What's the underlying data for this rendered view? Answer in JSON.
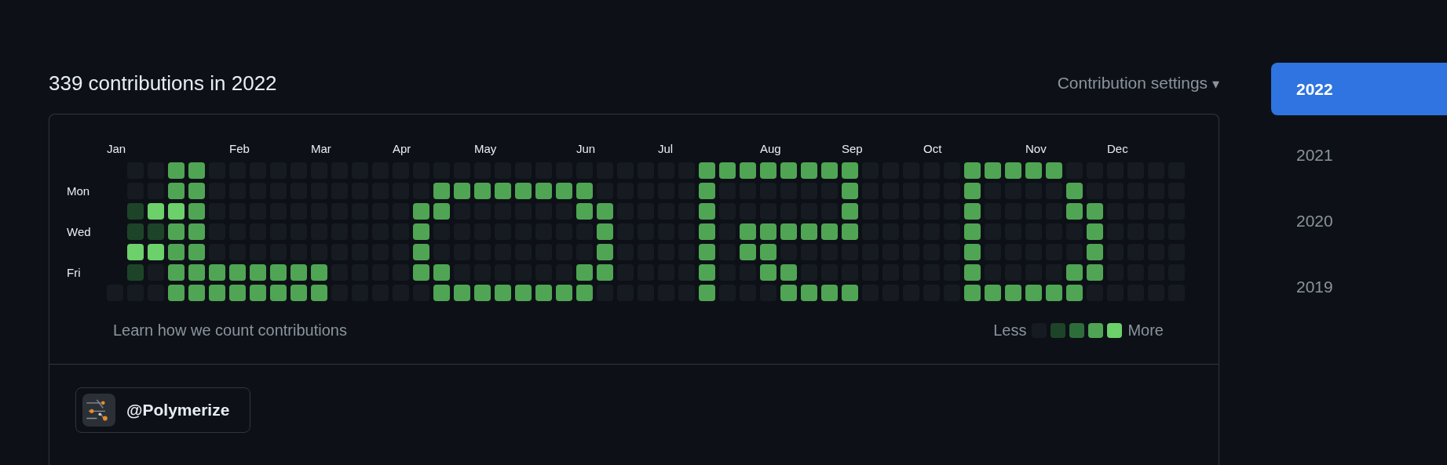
{
  "heading": "339 contributions in 2022",
  "settings_menu": {
    "label": "Contribution settings",
    "caret": "▾"
  },
  "years": [
    {
      "label": "2022",
      "selected": true
    },
    {
      "label": "2021",
      "selected": false
    },
    {
      "label": "2020",
      "selected": false
    },
    {
      "label": "2019",
      "selected": false
    }
  ],
  "day_labels": [
    "Mon",
    "Wed",
    "Fri"
  ],
  "weeks": [
    {
      "month": "Jan",
      "days": [
        {
          "color": "#161b22"
        }
      ]
    },
    {
      "days": [
        {
          "color": "#161b22"
        },
        {
          "color": "#161b22"
        },
        {
          "color": "#1d4428"
        },
        {
          "color": "#1d4428"
        },
        {
          "color": "#6cd06b"
        },
        {
          "color": "#1d4428"
        },
        {
          "color": "#161b22"
        }
      ]
    },
    {
      "days": [
        {
          "color": "#161b22"
        },
        {
          "color": "#161b22"
        },
        {
          "color": "#6cd06b"
        },
        {
          "color": "#1d4428"
        },
        {
          "color": "#6cd06b"
        },
        {
          "color": "#161b22"
        },
        {
          "color": "#161b22"
        }
      ]
    },
    {
      "days": [
        {
          "color": "#4fa553"
        },
        {
          "color": "#4fa553"
        },
        {
          "color": "#6cd06b"
        },
        {
          "color": "#4fa553"
        },
        {
          "color": "#4fa553"
        },
        {
          "color": "#4fa553"
        },
        {
          "color": "#4fa553"
        }
      ]
    },
    {
      "days": [
        {
          "color": "#4fa553"
        },
        {
          "color": "#4fa553"
        },
        {
          "color": "#4fa553"
        },
        {
          "color": "#4fa553"
        },
        {
          "color": "#4fa553"
        },
        {
          "color": "#4fa553"
        },
        {
          "color": "#4fa553"
        }
      ]
    },
    {
      "days": [
        {
          "color": "#161b22"
        },
        {
          "color": "#161b22"
        },
        {
          "color": "#161b22"
        },
        {
          "color": "#161b22"
        },
        {
          "color": "#161b22"
        },
        {
          "color": "#4fa553"
        },
        {
          "color": "#4fa553"
        }
      ]
    },
    {
      "month": "Feb",
      "days": [
        {
          "color": "#161b22"
        },
        {
          "color": "#161b22"
        },
        {
          "color": "#161b22"
        },
        {
          "color": "#161b22"
        },
        {
          "color": "#161b22"
        },
        {
          "color": "#4fa553"
        },
        {
          "color": "#4fa553"
        }
      ]
    },
    {
      "days": [
        {
          "color": "#161b22"
        },
        {
          "color": "#161b22"
        },
        {
          "color": "#161b22"
        },
        {
          "color": "#161b22"
        },
        {
          "color": "#161b22"
        },
        {
          "color": "#4fa553"
        },
        {
          "color": "#4fa553"
        }
      ]
    },
    {
      "days": [
        {
          "color": "#161b22"
        },
        {
          "color": "#161b22"
        },
        {
          "color": "#161b22"
        },
        {
          "color": "#161b22"
        },
        {
          "color": "#161b22"
        },
        {
          "color": "#4fa553"
        },
        {
          "color": "#4fa553"
        }
      ]
    },
    {
      "days": [
        {
          "color": "#161b22"
        },
        {
          "color": "#161b22"
        },
        {
          "color": "#161b22"
        },
        {
          "color": "#161b22"
        },
        {
          "color": "#161b22"
        },
        {
          "color": "#4fa553"
        },
        {
          "color": "#4fa553"
        }
      ]
    },
    {
      "month": "Mar",
      "days": [
        {
          "color": "#161b22"
        },
        {
          "color": "#161b22"
        },
        {
          "color": "#161b22"
        },
        {
          "color": "#161b22"
        },
        {
          "color": "#161b22"
        },
        {
          "color": "#4fa553"
        },
        {
          "color": "#4fa553"
        }
      ]
    },
    {
      "days": [
        {
          "color": "#161b22"
        },
        {
          "color": "#161b22"
        },
        {
          "color": "#161b22"
        },
        {
          "color": "#161b22"
        },
        {
          "color": "#161b22"
        },
        {
          "color": "#161b22"
        },
        {
          "color": "#161b22"
        }
      ]
    },
    {
      "days": [
        {
          "color": "#161b22"
        },
        {
          "color": "#161b22"
        },
        {
          "color": "#161b22"
        },
        {
          "color": "#161b22"
        },
        {
          "color": "#161b22"
        },
        {
          "color": "#161b22"
        },
        {
          "color": "#161b22"
        }
      ]
    },
    {
      "days": [
        {
          "color": "#161b22"
        },
        {
          "color": "#161b22"
        },
        {
          "color": "#161b22"
        },
        {
          "color": "#161b22"
        },
        {
          "color": "#161b22"
        },
        {
          "color": "#161b22"
        },
        {
          "color": "#161b22"
        }
      ]
    },
    {
      "month": "Apr",
      "days": [
        {
          "color": "#161b22"
        },
        {
          "color": "#161b22"
        },
        {
          "color": "#161b22"
        },
        {
          "color": "#161b22"
        },
        {
          "color": "#161b22"
        },
        {
          "color": "#161b22"
        },
        {
          "color": "#161b22"
        }
      ]
    },
    {
      "days": [
        {
          "color": "#161b22"
        },
        {
          "color": "#161b22"
        },
        {
          "color": "#4fa553"
        },
        {
          "color": "#4fa553"
        },
        {
          "color": "#4fa553"
        },
        {
          "color": "#4fa553"
        },
        {
          "color": "#161b22"
        }
      ]
    },
    {
      "days": [
        {
          "color": "#161b22"
        },
        {
          "color": "#4fa553"
        },
        {
          "color": "#4fa553"
        },
        {
          "color": "#161b22"
        },
        {
          "color": "#161b22"
        },
        {
          "color": "#4fa553"
        },
        {
          "color": "#4fa553"
        }
      ]
    },
    {
      "days": [
        {
          "color": "#161b22"
        },
        {
          "color": "#4fa553"
        },
        {
          "color": "#161b22"
        },
        {
          "color": "#161b22"
        },
        {
          "color": "#161b22"
        },
        {
          "color": "#161b22"
        },
        {
          "color": "#4fa553"
        }
      ]
    },
    {
      "month": "May",
      "days": [
        {
          "color": "#161b22"
        },
        {
          "color": "#4fa553"
        },
        {
          "color": "#161b22"
        },
        {
          "color": "#161b22"
        },
        {
          "color": "#161b22"
        },
        {
          "color": "#161b22"
        },
        {
          "color": "#4fa553"
        }
      ]
    },
    {
      "days": [
        {
          "color": "#161b22"
        },
        {
          "color": "#4fa553"
        },
        {
          "color": "#161b22"
        },
        {
          "color": "#161b22"
        },
        {
          "color": "#161b22"
        },
        {
          "color": "#161b22"
        },
        {
          "color": "#4fa553"
        }
      ]
    },
    {
      "days": [
        {
          "color": "#161b22"
        },
        {
          "color": "#4fa553"
        },
        {
          "color": "#161b22"
        },
        {
          "color": "#161b22"
        },
        {
          "color": "#161b22"
        },
        {
          "color": "#161b22"
        },
        {
          "color": "#4fa553"
        }
      ]
    },
    {
      "days": [
        {
          "color": "#161b22"
        },
        {
          "color": "#4fa553"
        },
        {
          "color": "#161b22"
        },
        {
          "color": "#161b22"
        },
        {
          "color": "#161b22"
        },
        {
          "color": "#161b22"
        },
        {
          "color": "#4fa553"
        }
      ]
    },
    {
      "days": [
        {
          "color": "#161b22"
        },
        {
          "color": "#4fa553"
        },
        {
          "color": "#161b22"
        },
        {
          "color": "#161b22"
        },
        {
          "color": "#161b22"
        },
        {
          "color": "#161b22"
        },
        {
          "color": "#4fa553"
        }
      ]
    },
    {
      "month": "Jun",
      "days": [
        {
          "color": "#161b22"
        },
        {
          "color": "#4fa553"
        },
        {
          "color": "#4fa553"
        },
        {
          "color": "#161b22"
        },
        {
          "color": "#161b22"
        },
        {
          "color": "#4fa553"
        },
        {
          "color": "#4fa553"
        }
      ]
    },
    {
      "days": [
        {
          "color": "#161b22"
        },
        {
          "color": "#161b22"
        },
        {
          "color": "#4fa553"
        },
        {
          "color": "#4fa553"
        },
        {
          "color": "#4fa553"
        },
        {
          "color": "#4fa553"
        },
        {
          "color": "#161b22"
        }
      ]
    },
    {
      "days": [
        {
          "color": "#161b22"
        },
        {
          "color": "#161b22"
        },
        {
          "color": "#161b22"
        },
        {
          "color": "#161b22"
        },
        {
          "color": "#161b22"
        },
        {
          "color": "#161b22"
        },
        {
          "color": "#161b22"
        }
      ]
    },
    {
      "days": [
        {
          "color": "#161b22"
        },
        {
          "color": "#161b22"
        },
        {
          "color": "#161b22"
        },
        {
          "color": "#161b22"
        },
        {
          "color": "#161b22"
        },
        {
          "color": "#161b22"
        },
        {
          "color": "#161b22"
        }
      ]
    },
    {
      "month": "Jul",
      "days": [
        {
          "color": "#161b22"
        },
        {
          "color": "#161b22"
        },
        {
          "color": "#161b22"
        },
        {
          "color": "#161b22"
        },
        {
          "color": "#161b22"
        },
        {
          "color": "#161b22"
        },
        {
          "color": "#161b22"
        }
      ]
    },
    {
      "days": [
        {
          "color": "#161b22"
        },
        {
          "color": "#161b22"
        },
        {
          "color": "#161b22"
        },
        {
          "color": "#161b22"
        },
        {
          "color": "#161b22"
        },
        {
          "color": "#161b22"
        },
        {
          "color": "#161b22"
        }
      ]
    },
    {
      "days": [
        {
          "color": "#4fa553"
        },
        {
          "color": "#4fa553"
        },
        {
          "color": "#4fa553"
        },
        {
          "color": "#4fa553"
        },
        {
          "color": "#4fa553"
        },
        {
          "color": "#4fa553"
        },
        {
          "color": "#4fa553"
        }
      ]
    },
    {
      "days": [
        {
          "color": "#4fa553"
        },
        {
          "color": "#161b22"
        },
        {
          "color": "#161b22"
        },
        {
          "color": "#161b22"
        },
        {
          "color": "#161b22"
        },
        {
          "color": "#161b22"
        },
        {
          "color": "#161b22"
        }
      ]
    },
    {
      "days": [
        {
          "color": "#4fa553"
        },
        {
          "color": "#161b22"
        },
        {
          "color": "#161b22"
        },
        {
          "color": "#4fa553"
        },
        {
          "color": "#4fa553"
        },
        {
          "color": "#161b22"
        },
        {
          "color": "#161b22"
        }
      ]
    },
    {
      "month": "Aug",
      "days": [
        {
          "color": "#4fa553"
        },
        {
          "color": "#161b22"
        },
        {
          "color": "#161b22"
        },
        {
          "color": "#4fa553"
        },
        {
          "color": "#4fa553"
        },
        {
          "color": "#4fa553"
        },
        {
          "color": "#161b22"
        }
      ]
    },
    {
      "days": [
        {
          "color": "#4fa553"
        },
        {
          "color": "#161b22"
        },
        {
          "color": "#161b22"
        },
        {
          "color": "#4fa553"
        },
        {
          "color": "#161b22"
        },
        {
          "color": "#4fa553"
        },
        {
          "color": "#4fa553"
        }
      ]
    },
    {
      "days": [
        {
          "color": "#4fa553"
        },
        {
          "color": "#161b22"
        },
        {
          "color": "#161b22"
        },
        {
          "color": "#4fa553"
        },
        {
          "color": "#161b22"
        },
        {
          "color": "#161b22"
        },
        {
          "color": "#4fa553"
        }
      ]
    },
    {
      "days": [
        {
          "color": "#4fa553"
        },
        {
          "color": "#161b22"
        },
        {
          "color": "#161b22"
        },
        {
          "color": "#4fa553"
        },
        {
          "color": "#161b22"
        },
        {
          "color": "#161b22"
        },
        {
          "color": "#4fa553"
        }
      ]
    },
    {
      "month": "Sep",
      "days": [
        {
          "color": "#4fa553"
        },
        {
          "color": "#4fa553"
        },
        {
          "color": "#4fa553"
        },
        {
          "color": "#4fa553"
        },
        {
          "color": "#161b22"
        },
        {
          "color": "#161b22"
        },
        {
          "color": "#4fa553"
        }
      ]
    },
    {
      "days": [
        {
          "color": "#161b22"
        },
        {
          "color": "#161b22"
        },
        {
          "color": "#161b22"
        },
        {
          "color": "#161b22"
        },
        {
          "color": "#161b22"
        },
        {
          "color": "#161b22"
        },
        {
          "color": "#161b22"
        }
      ]
    },
    {
      "days": [
        {
          "color": "#161b22"
        },
        {
          "color": "#161b22"
        },
        {
          "color": "#161b22"
        },
        {
          "color": "#161b22"
        },
        {
          "color": "#161b22"
        },
        {
          "color": "#161b22"
        },
        {
          "color": "#161b22"
        }
      ]
    },
    {
      "days": [
        {
          "color": "#161b22"
        },
        {
          "color": "#161b22"
        },
        {
          "color": "#161b22"
        },
        {
          "color": "#161b22"
        },
        {
          "color": "#161b22"
        },
        {
          "color": "#161b22"
        },
        {
          "color": "#161b22"
        }
      ]
    },
    {
      "month": "Oct",
      "days": [
        {
          "color": "#161b22"
        },
        {
          "color": "#161b22"
        },
        {
          "color": "#161b22"
        },
        {
          "color": "#161b22"
        },
        {
          "color": "#161b22"
        },
        {
          "color": "#161b22"
        },
        {
          "color": "#161b22"
        }
      ]
    },
    {
      "days": [
        {
          "color": "#161b22"
        },
        {
          "color": "#161b22"
        },
        {
          "color": "#161b22"
        },
        {
          "color": "#161b22"
        },
        {
          "color": "#161b22"
        },
        {
          "color": "#161b22"
        },
        {
          "color": "#161b22"
        }
      ]
    },
    {
      "days": [
        {
          "color": "#4fa553"
        },
        {
          "color": "#4fa553"
        },
        {
          "color": "#4fa553"
        },
        {
          "color": "#4fa553"
        },
        {
          "color": "#4fa553"
        },
        {
          "color": "#4fa553"
        },
        {
          "color": "#4fa553"
        }
      ]
    },
    {
      "days": [
        {
          "color": "#4fa553"
        },
        {
          "color": "#161b22"
        },
        {
          "color": "#161b22"
        },
        {
          "color": "#161b22"
        },
        {
          "color": "#161b22"
        },
        {
          "color": "#161b22"
        },
        {
          "color": "#4fa553"
        }
      ]
    },
    {
      "days": [
        {
          "color": "#4fa553"
        },
        {
          "color": "#161b22"
        },
        {
          "color": "#161b22"
        },
        {
          "color": "#161b22"
        },
        {
          "color": "#161b22"
        },
        {
          "color": "#161b22"
        },
        {
          "color": "#4fa553"
        }
      ]
    },
    {
      "month": "Nov",
      "days": [
        {
          "color": "#4fa553"
        },
        {
          "color": "#161b22"
        },
        {
          "color": "#161b22"
        },
        {
          "color": "#161b22"
        },
        {
          "color": "#161b22"
        },
        {
          "color": "#161b22"
        },
        {
          "color": "#4fa553"
        }
      ]
    },
    {
      "days": [
        {
          "color": "#4fa553"
        },
        {
          "color": "#161b22"
        },
        {
          "color": "#161b22"
        },
        {
          "color": "#161b22"
        },
        {
          "color": "#161b22"
        },
        {
          "color": "#161b22"
        },
        {
          "color": "#4fa553"
        }
      ]
    },
    {
      "days": [
        {
          "color": "#161b22"
        },
        {
          "color": "#4fa553"
        },
        {
          "color": "#4fa553"
        },
        {
          "color": "#161b22"
        },
        {
          "color": "#161b22"
        },
        {
          "color": "#4fa553"
        },
        {
          "color": "#4fa553"
        }
      ]
    },
    {
      "days": [
        {
          "color": "#161b22"
        },
        {
          "color": "#161b22"
        },
        {
          "color": "#4fa553"
        },
        {
          "color": "#4fa553"
        },
        {
          "color": "#4fa553"
        },
        {
          "color": "#4fa553"
        },
        {
          "color": "#161b22"
        }
      ]
    },
    {
      "month": "Dec",
      "days": [
        {
          "color": "#161b22"
        },
        {
          "color": "#161b22"
        },
        {
          "color": "#161b22"
        },
        {
          "color": "#161b22"
        },
        {
          "color": "#161b22"
        },
        {
          "color": "#161b22"
        },
        {
          "color": "#161b22"
        }
      ]
    },
    {
      "days": [
        {
          "color": "#161b22"
        },
        {
          "color": "#161b22"
        },
        {
          "color": "#161b22"
        },
        {
          "color": "#161b22"
        },
        {
          "color": "#161b22"
        },
        {
          "color": "#161b22"
        },
        {
          "color": "#161b22"
        }
      ]
    },
    {
      "days": [
        {
          "color": "#161b22"
        },
        {
          "color": "#161b22"
        },
        {
          "color": "#161b22"
        },
        {
          "color": "#161b22"
        },
        {
          "color": "#161b22"
        },
        {
          "color": "#161b22"
        },
        {
          "color": "#161b22"
        }
      ]
    },
    {
      "days": [
        {
          "color": "#161b22"
        },
        {
          "color": "#161b22"
        },
        {
          "color": "#161b22"
        },
        {
          "color": "#161b22"
        },
        {
          "color": "#161b22"
        },
        {
          "color": "#161b22"
        },
        {
          "color": "#161b22"
        }
      ]
    }
  ],
  "learn_link": "Learn how we count contributions",
  "legend": {
    "less": "Less",
    "more": "More",
    "swatches": [
      {
        "color": "#161b22"
      },
      {
        "color": "#1d4428"
      },
      {
        "color": "#2d6d3a"
      },
      {
        "color": "#4fa553"
      },
      {
        "color": "#6cd06b"
      }
    ]
  },
  "organization": {
    "name": "@Polymerize"
  }
}
